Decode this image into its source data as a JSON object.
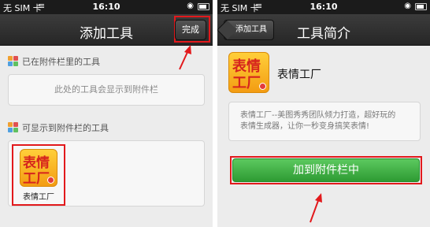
{
  "status_bar": {
    "carrier": "无 SIM 卡",
    "time": "16:10"
  },
  "left_screen": {
    "nav_title": "添加工具",
    "done_button": "完成",
    "section_in_bar": {
      "label": "已在附件栏里的工具",
      "placeholder": "此处的工具会显示到附件栏"
    },
    "section_available": {
      "label": "可显示到附件栏的工具",
      "tool": {
        "icon_text_top": "表情",
        "icon_text_bottom": "工厂",
        "name": "表情工厂"
      }
    }
  },
  "right_screen": {
    "nav_title": "工具简介",
    "back_button": "添加工具",
    "tool": {
      "icon_text_top": "表情",
      "icon_text_bottom": "工厂",
      "name": "表情工厂"
    },
    "description_line1": "表情工厂--美图秀秀团队倾力打造，超好玩的",
    "description_line2": "表情生成器，让你一秒变身搞笑表情!",
    "add_button": "加到附件栏中"
  },
  "colors": {
    "highlight_red": "#e2191c",
    "add_button_green": "#3cad41",
    "navbar_dark": "#2f2f2f"
  },
  "icons": [
    "wifi-icon",
    "lock-icon",
    "battery-icon",
    "apps-icon",
    "apps-icon",
    "app-icon-biaoqing-gongchang",
    "annotation-arrow"
  ]
}
